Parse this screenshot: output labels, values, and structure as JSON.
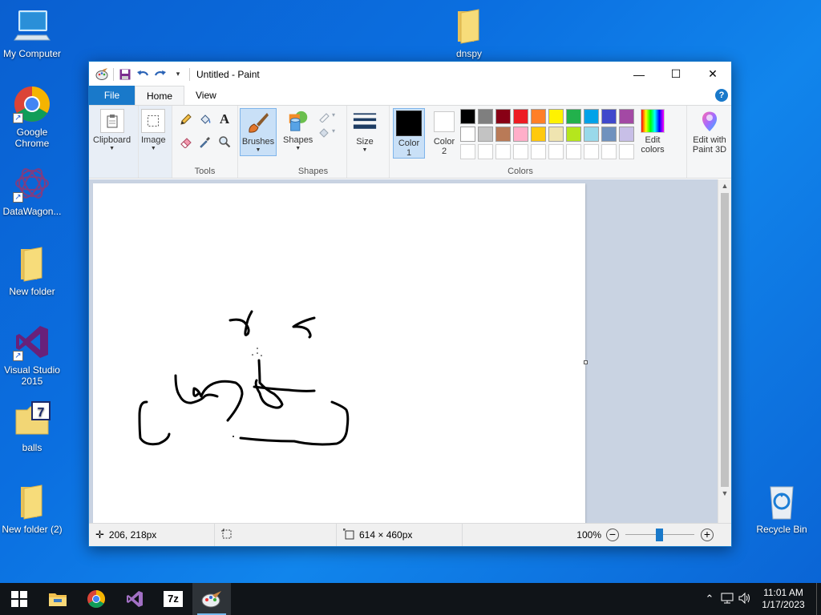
{
  "desktop": {
    "icons": [
      {
        "label": "My Computer",
        "icon": "computer-icon"
      },
      {
        "label": "Google Chrome",
        "icon": "chrome-icon"
      },
      {
        "label": "DataWagon...",
        "icon": "datawagon-icon"
      },
      {
        "label": "New folder",
        "icon": "folder-icon"
      },
      {
        "label": "Visual Studio 2015",
        "icon": "visual-studio-icon"
      },
      {
        "label": "balls",
        "icon": "7zip-archive-icon"
      },
      {
        "label": "New folder (2)",
        "icon": "folder-icon"
      },
      {
        "label": "dnspy",
        "icon": "folder-icon"
      },
      {
        "label": "Recycle Bin",
        "icon": "recycle-bin-icon"
      }
    ]
  },
  "window": {
    "title": "Untitled - Paint",
    "quick_access": [
      "paint-app-icon",
      "save-icon",
      "undo-icon",
      "redo-icon",
      "customize-dropdown-icon"
    ],
    "controls": {
      "minimize": "—",
      "maximize": "☐",
      "close": "✕"
    }
  },
  "tabs": {
    "file": "File",
    "home": "Home",
    "view": "View",
    "help": "?"
  },
  "ribbon": {
    "clipboard": {
      "label": "Clipboard"
    },
    "image": {
      "label": "Image"
    },
    "tools": {
      "group_label": "Tools",
      "items": [
        "pencil-icon",
        "fill-icon",
        "text-icon",
        "eraser-icon",
        "color-picker-icon",
        "magnifier-icon"
      ]
    },
    "brushes": {
      "label": "Brushes"
    },
    "shapes": {
      "label": "Shapes",
      "group_label": "Shapes",
      "outline": "outline-icon",
      "fill": "fill-shape-icon"
    },
    "size": {
      "label": "Size"
    },
    "color1": {
      "label_line1": "Color",
      "label_line2": "1",
      "value": "#000000"
    },
    "color2": {
      "label_line1": "Color",
      "label_line2": "2",
      "value": "#ffffff"
    },
    "palette": {
      "group_label": "Colors",
      "row1": [
        "#000000",
        "#7f7f7f",
        "#880015",
        "#ed1c24",
        "#ff7f27",
        "#fff200",
        "#22b14c",
        "#00a2e8",
        "#3f48cc",
        "#a349a4"
      ],
      "row2": [
        "#ffffff",
        "#c3c3c3",
        "#b97a57",
        "#ffaec9",
        "#ffc90e",
        "#efe4b0",
        "#b5e61d",
        "#99d9ea",
        "#7092be",
        "#c8bfe7"
      ],
      "row3": [
        "#ffffff",
        "#ffffff",
        "#ffffff",
        "#ffffff",
        "#ffffff",
        "#ffffff",
        "#ffffff",
        "#ffffff",
        "#ffffff",
        "#ffffff"
      ]
    },
    "edit_colors": {
      "line1": "Edit",
      "line2": "colors"
    },
    "paint3d": {
      "line1": "Edit with",
      "line2": "Paint 3D"
    }
  },
  "status": {
    "cursor_pos": "206, 218px",
    "selection_size": "",
    "canvas_size": "614 × 460px",
    "zoom": "100%"
  },
  "taskbar": {
    "pinned": [
      "windows-start-icon",
      "file-explorer-icon",
      "chrome-icon",
      "visual-studio-icon",
      "7zip-icon",
      "paint-icon"
    ],
    "active": "paint-icon",
    "time": "11:01 AM",
    "date": "1/17/2023"
  }
}
